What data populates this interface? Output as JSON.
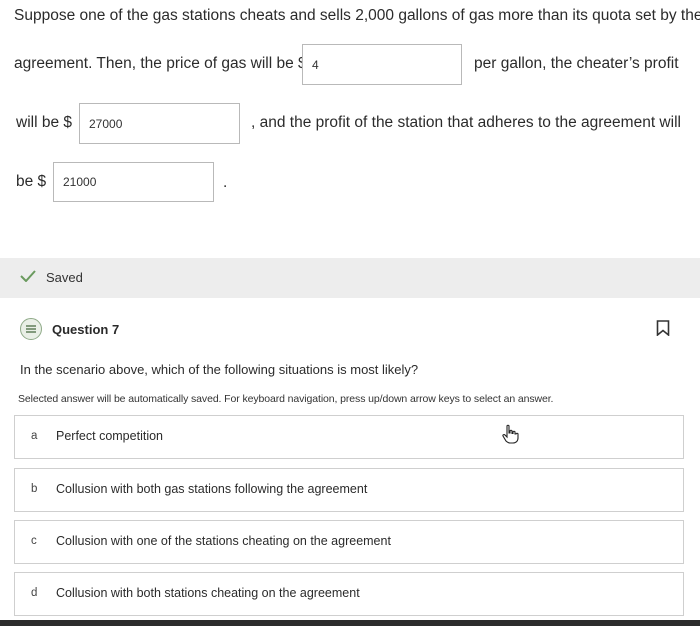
{
  "question6": {
    "line1": "Suppose one of the gas stations cheats and sells 2,000 gallons of gas more than its quota set by the",
    "line2_prefix": "agreement. Then, the price of gas will be $",
    "price_value": "4",
    "line2_suffix": "per gallon, the cheater’s profit",
    "line3_prefix": "will be $",
    "cheater_profit_value": "27000",
    "line3_suffix": ", and the profit of the station that adheres to the agreement will",
    "line4_prefix": "be $",
    "adherer_profit_value": "21000",
    "line4_suffix": "."
  },
  "status": {
    "icon": "check-icon",
    "label": "Saved"
  },
  "question7": {
    "icon": "question-list-icon",
    "title": "Question 7",
    "bookmark_icon": "bookmark-icon",
    "prompt": "In the scenario above, which of the following situations is most likely?",
    "instructions": "Selected answer will be automatically saved. For keyboard navigation, press up/down arrow keys to select an answer.",
    "options": [
      {
        "letter": "a",
        "text": "Perfect competition"
      },
      {
        "letter": "b",
        "text": "Collusion with both gas stations following the agreement"
      },
      {
        "letter": "c",
        "text": "Collusion with one of the stations cheating on the agreement"
      },
      {
        "letter": "d",
        "text": "Collusion with both stations cheating on the agreement"
      }
    ]
  },
  "colors": {
    "saved_bar": "#ededed",
    "check": "#6a9a5e",
    "option_border": "#cfcfcf"
  }
}
